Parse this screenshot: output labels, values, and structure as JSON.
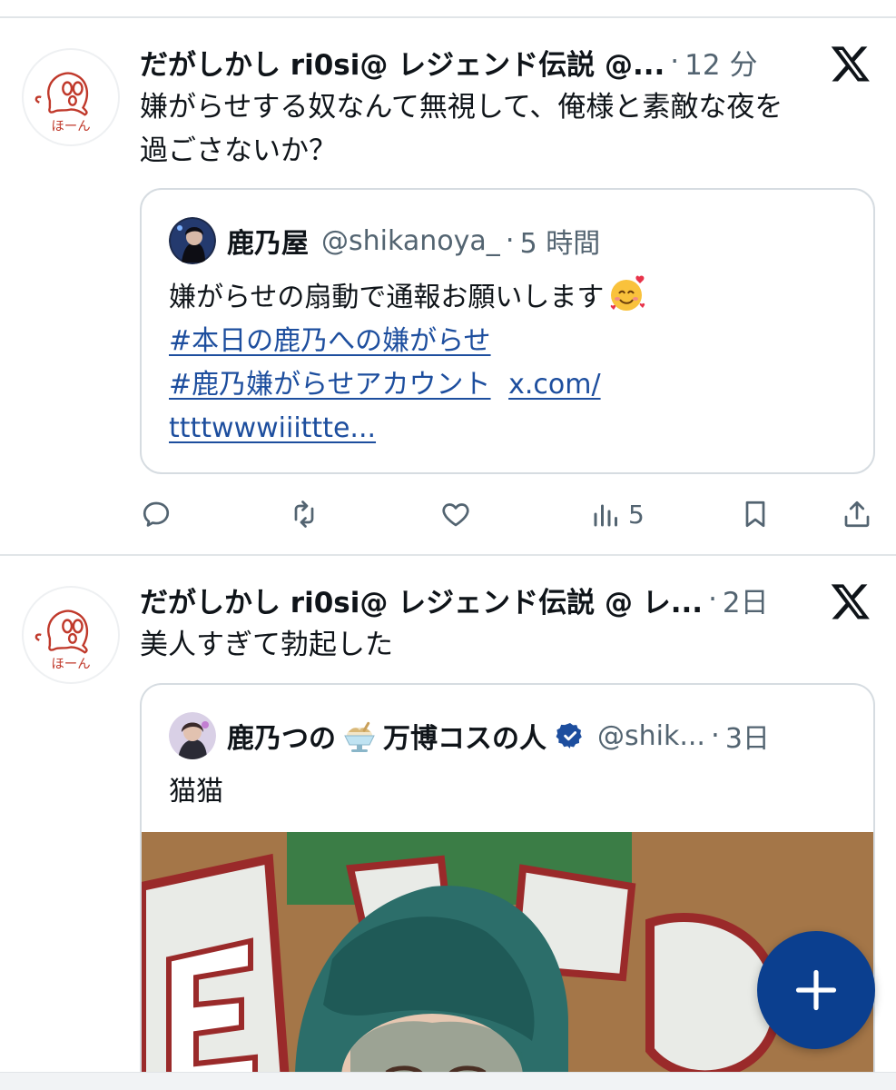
{
  "posts": [
    {
      "author": "だがしかし ri0si@ レジェンド伝説 @...",
      "separator": "·",
      "time": "12 分",
      "text_line1": "嫌がらせする奴なんて無視して、俺様と素敵な夜を",
      "text_line2": "過ごさないか？",
      "avatar_text": "ほーん",
      "quote": {
        "name": "鹿乃屋",
        "handle": "@shikanoya_",
        "separator": "·",
        "time": "5 時間",
        "text": "嫌がらせの扇動で通報お願いします",
        "emoji": "smiling-face-with-hearts",
        "hashtag1": "#本日の鹿乃への嫌がらせ",
        "hashtag2": "#鹿乃嫌がらせアカウント",
        "link1": "x.com/",
        "link2": "ttttwwwiiittte..."
      },
      "actions": {
        "reply_icon": "reply-icon",
        "repost_icon": "repost-icon",
        "like_icon": "like-icon",
        "views_icon": "views-icon",
        "views_count": "5",
        "bookmark_icon": "bookmark-icon",
        "share_icon": "share-icon"
      }
    },
    {
      "author": "だがしかし ri0si@ レジェンド伝説 @ レ...",
      "separator": "·",
      "time": "2日",
      "text_line1": "美人すぎて勃起した",
      "avatar_text": "ほーん",
      "quote": {
        "name_part1": "鹿乃つの",
        "name_emoji": "shaved-ice",
        "name_part2": "万博コスの人",
        "verified_icon": "verified-badge-icon",
        "handle": "@shik...",
        "separator": "·",
        "time": "3日",
        "text": "猫猫"
      }
    }
  ],
  "fab": {
    "icon": "plus-icon"
  },
  "colors": {
    "text": "#0f1419",
    "muted": "#536471",
    "link": "#1d4e9e",
    "fab": "#0b3f8f",
    "border": "#d6dce1",
    "avatar_ink": "#c0392b"
  }
}
